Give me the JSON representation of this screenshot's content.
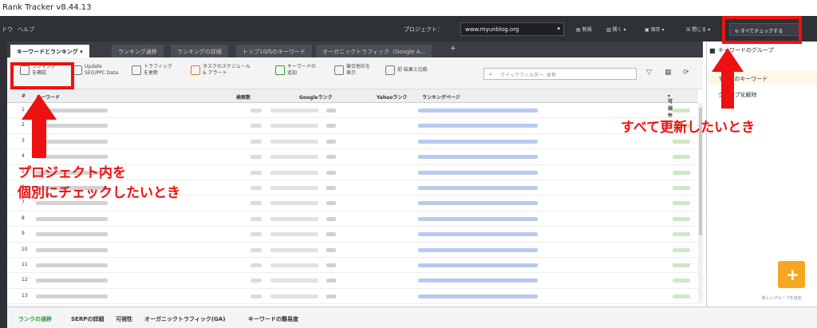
{
  "window": {
    "title": "Rank Tracker v8.44.13"
  },
  "menu": {
    "items": [
      "ドウ",
      "ヘルプ"
    ]
  },
  "project": {
    "label": "プロジェクト：",
    "selected": "www.myunblog.org"
  },
  "top_toolbar": {
    "new": "新規",
    "open": "開く",
    "save": "保存",
    "close": "閉じる",
    "check_all": "すべてチェックする"
  },
  "tabs": [
    {
      "label": "キーワードとランキング",
      "active": true
    },
    {
      "label": "ランキング通移",
      "active": false
    },
    {
      "label": "ランキングの詳細",
      "active": false
    },
    {
      "label": "トップ10内のキーワード",
      "active": false
    },
    {
      "label": "オーガニックトラフィック（Google A...",
      "active": false
    }
  ],
  "tab_add": "+",
  "toolbar": {
    "check_rank": [
      "ランキング",
      "を確認"
    ],
    "update_serp": [
      "Update",
      "SEO/PPC Data"
    ],
    "traffic": [
      "トラフィック",
      "を更新"
    ],
    "schedule": [
      "タスクのスケジュール",
      "& アラート"
    ],
    "add_keyword": [
      "キーワードの",
      "追加"
    ],
    "competitors": [
      "競合他社を",
      "表示"
    ],
    "compare": [
      "前 結果と比較"
    ],
    "filter_placeholder": "クイックフィルター: 含有"
  },
  "grid": {
    "columns": {
      "num": "#",
      "keyword": "キーワード",
      "search": "検索数",
      "google": "Googleランク",
      "yahoo": "Yahooランク",
      "page": "ランキングページ",
      "vis": "可視性"
    },
    "rows": [
      "1",
      "2",
      "3",
      "4",
      "5",
      "6",
      "7",
      "8",
      "9",
      "10",
      "11",
      "12",
      "13"
    ]
  },
  "bottom_tabs": [
    "ランクの通移",
    "SERPの詳細",
    "可視性",
    "オーガニックトラフィック(GA)",
    "キーワードの難易度"
  ],
  "right_panel": {
    "title": "キーワードのグループ",
    "items": [
      "すべてのキーワード",
      "グループ化解除"
    ],
    "new_group": "新しいグループを追加"
  },
  "annotations": {
    "left": [
      "プロジェクト内を",
      "個別にチェックしたいとき"
    ],
    "right": "すべて更新したいとき"
  },
  "colors": {
    "annotation": "#ee1111",
    "menubar": "#2e3136",
    "active_bottom": "#2aa13d",
    "folder": "#f5a623"
  }
}
